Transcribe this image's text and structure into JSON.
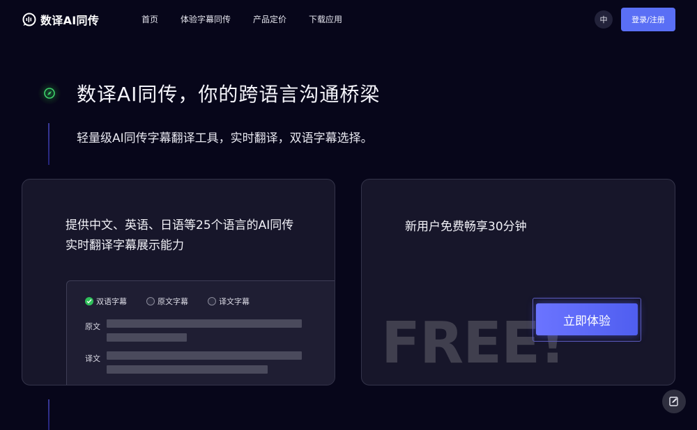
{
  "brand": {
    "name": "数译AI同传"
  },
  "nav": {
    "items": [
      {
        "label": "首页"
      },
      {
        "label": "体验字幕同传"
      },
      {
        "label": "产品定价"
      },
      {
        "label": "下载应用"
      }
    ],
    "lang_label": "中",
    "login_label": "登录/注册"
  },
  "hero": {
    "icon": "compass-icon",
    "title": "数译AI同传，你的跨语言沟通桥梁",
    "subtitle": "轻量级AI同传字幕翻译工具，实时翻译，双语字幕选择。"
  },
  "feature_card": {
    "description": "提供中文、英语、日语等25个语言的AI同传实时翻译字幕展示能力",
    "options": [
      {
        "label": "双语字幕",
        "selected": true
      },
      {
        "label": "原文字幕",
        "selected": false
      },
      {
        "label": "译文字幕",
        "selected": false
      }
    ],
    "source_label": "原文",
    "target_label": "译文"
  },
  "free_card": {
    "text": "新用户免费畅享30分钟",
    "decor": "FREE!",
    "button_label": "立即体验"
  },
  "colors": {
    "background": "#07061a",
    "accent": "#5a6ff5",
    "card": "#17162a",
    "check": "#2fbf5a"
  },
  "icons": {
    "feedback": "edit-note-icon"
  }
}
